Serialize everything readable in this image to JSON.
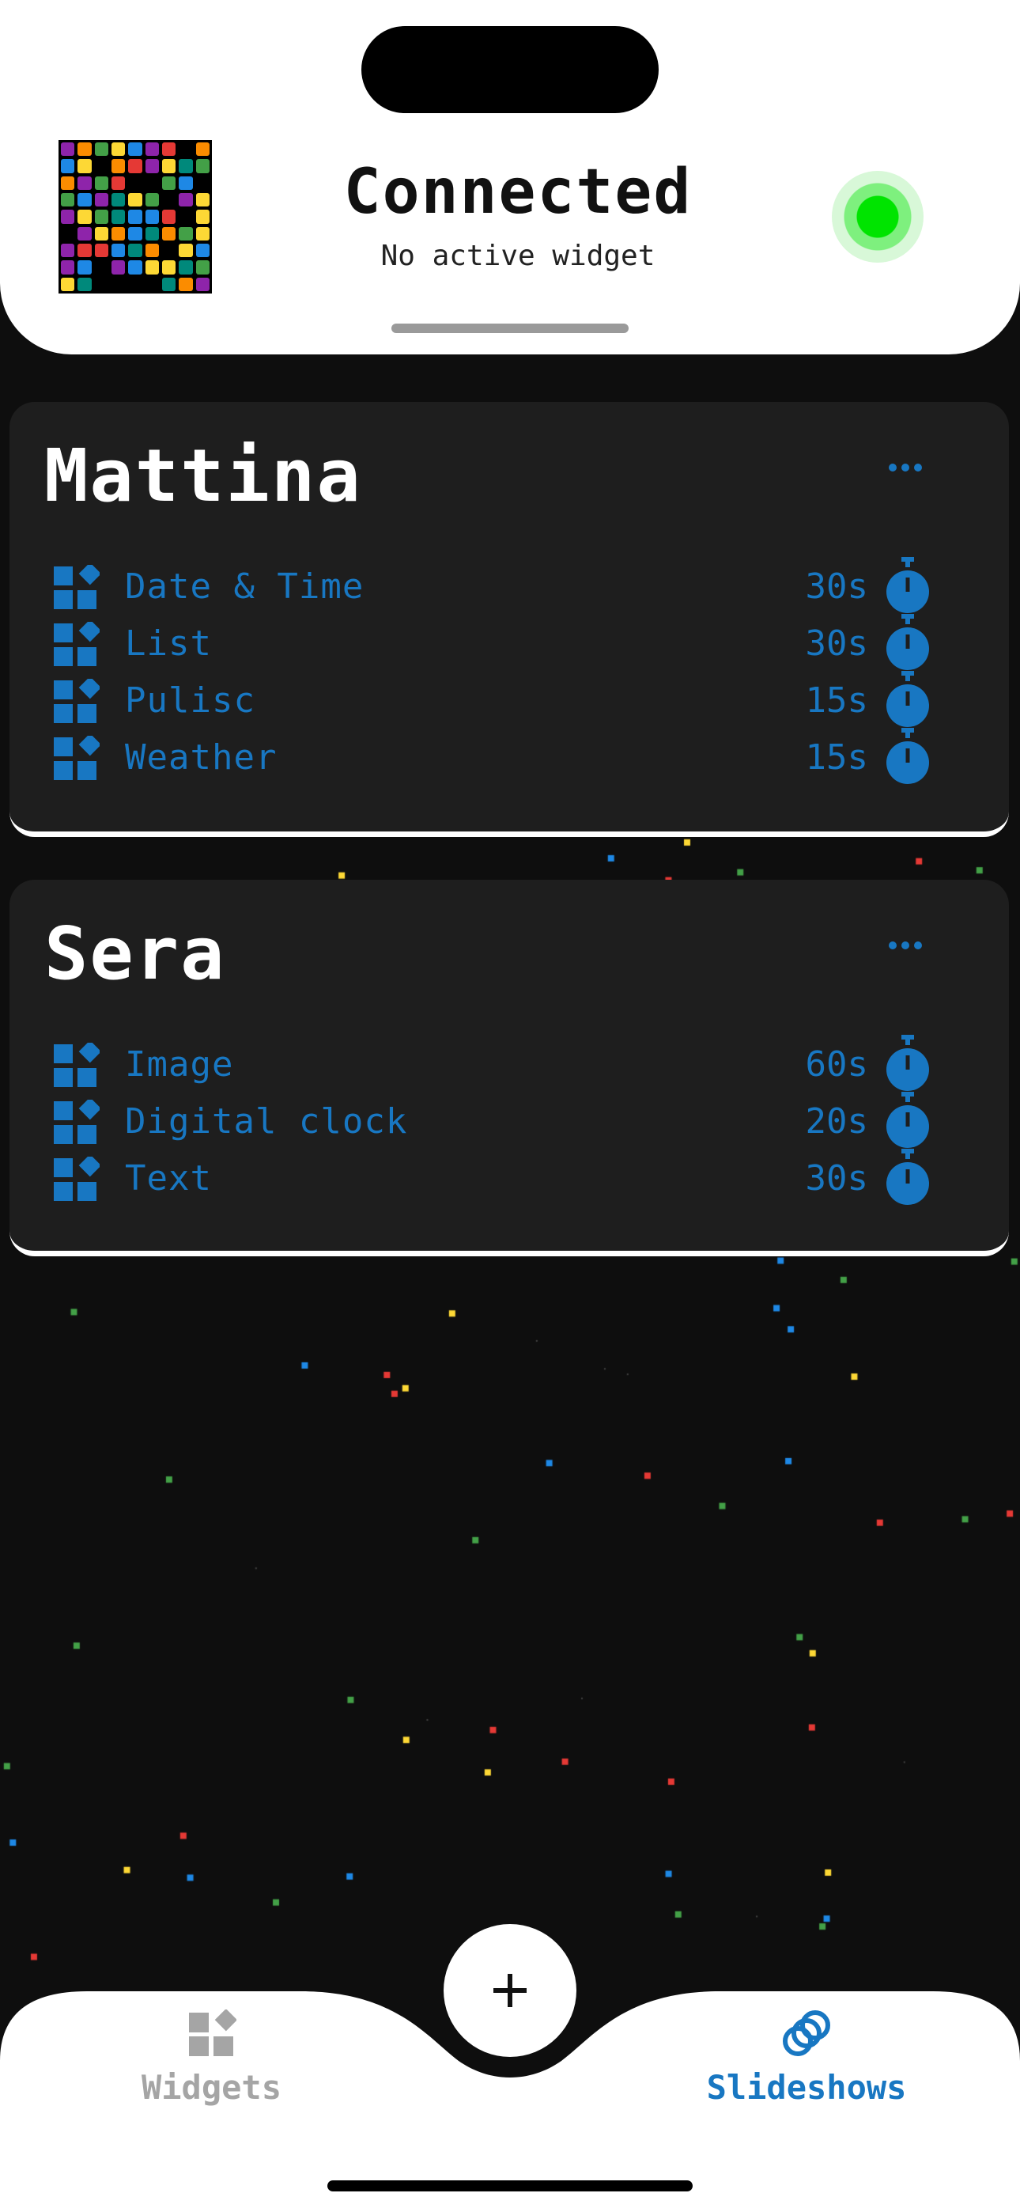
{
  "header": {
    "status_title": "Connected",
    "status_subtitle": "No active widget",
    "connection_color": "#00e400"
  },
  "slideshows": [
    {
      "title": "Mattina",
      "items": [
        {
          "label": "Date & Time",
          "duration": "30s"
        },
        {
          "label": "List",
          "duration": "30s"
        },
        {
          "label": "Pulisc",
          "duration": "15s"
        },
        {
          "label": "Weather",
          "duration": "15s"
        }
      ]
    },
    {
      "title": "Sera",
      "items": [
        {
          "label": "Image",
          "duration": "60s"
        },
        {
          "label": "Digital clock",
          "duration": "20s"
        },
        {
          "label": "Text",
          "duration": "30s"
        }
      ]
    }
  ],
  "tabbar": {
    "widgets_label": "Widgets",
    "slideshows_label": "Slideshows",
    "active_tab": "Slideshows"
  },
  "colors": {
    "accent": "#1877c2",
    "card_bg": "#1e1e1e",
    "page_bg": "#0e0e0e"
  }
}
